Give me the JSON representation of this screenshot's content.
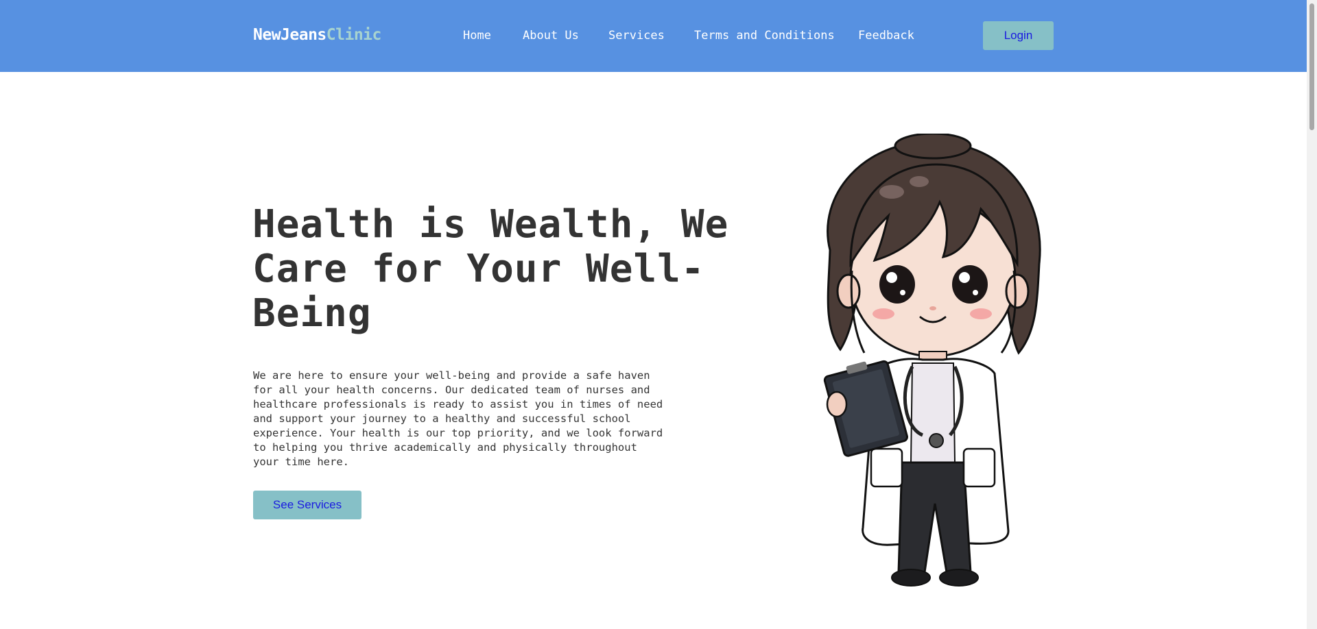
{
  "brand": {
    "name_main": "NewJeans",
    "name_accent": "Clinic"
  },
  "nav": {
    "items": [
      {
        "label": "Home"
      },
      {
        "label": "About Us"
      },
      {
        "label": "Services"
      },
      {
        "label": "Terms and Conditions"
      },
      {
        "label": "Feedback"
      }
    ],
    "login_label": "Login"
  },
  "hero": {
    "title": "Health is Wealth, We Care for Your Well-Being",
    "description": "We are here to ensure your well-being and provide a safe haven for all your health concerns. Our dedicated team of nurses and healthcare professionals is ready to assist you in times of need and support your journey to a healthy and successful school experience. Your health is our top priority, and we look forward to helping you thrive academically and physically throughout your time here.",
    "cta_label": "See Services"
  },
  "illustration": {
    "icon": "doctor-illustration"
  },
  "colors": {
    "navbar": "#5791e1",
    "accent": "#a8d3cf",
    "button": "#86c0c7",
    "button_text": "#1a1ae0",
    "text": "#333333"
  }
}
